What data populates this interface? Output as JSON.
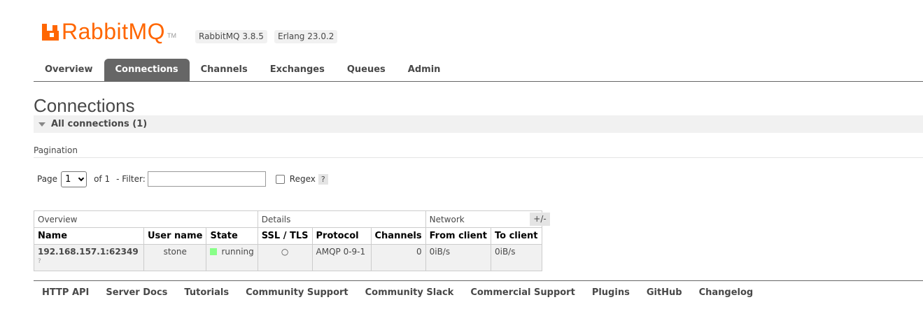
{
  "header": {
    "logo_text": "RabbitMQ",
    "logo_tm": "TM",
    "rabbitmq_version": "RabbitMQ 3.8.5",
    "erlang_version": "Erlang 23.0.2",
    "brand_color": "#ff6600"
  },
  "tabs": [
    {
      "label": "Overview",
      "active": false
    },
    {
      "label": "Connections",
      "active": true
    },
    {
      "label": "Channels",
      "active": false
    },
    {
      "label": "Exchanges",
      "active": false
    },
    {
      "label": "Queues",
      "active": false
    },
    {
      "label": "Admin",
      "active": false
    }
  ],
  "page": {
    "title": "Connections",
    "section_label": "All connections (1)",
    "pagination_title": "Pagination"
  },
  "pager": {
    "page_label": "Page",
    "page_value": "1",
    "of_label": "of 1",
    "filter_label": "- Filter:",
    "filter_value": "",
    "regex_label": "Regex",
    "regex_checked": false,
    "help": "?"
  },
  "table": {
    "groups": [
      "Overview",
      "Details",
      "Network"
    ],
    "columns": [
      "Name",
      "User name",
      "State",
      "SSL / TLS",
      "Protocol",
      "Channels",
      "From client",
      "To client"
    ],
    "toggle_label": "+/-",
    "rows": [
      {
        "name": "192.168.157.1:62349",
        "name_sub": "?",
        "user": "stone",
        "state": "running",
        "ssl": "○",
        "protocol": "AMQP 0-9-1",
        "channels": "0",
        "from_client": "0iB/s",
        "to_client": "0iB/s"
      }
    ]
  },
  "footer": {
    "links": [
      "HTTP API",
      "Server Docs",
      "Tutorials",
      "Community Support",
      "Community Slack",
      "Commercial Support",
      "Plugins",
      "GitHub",
      "Changelog"
    ]
  }
}
